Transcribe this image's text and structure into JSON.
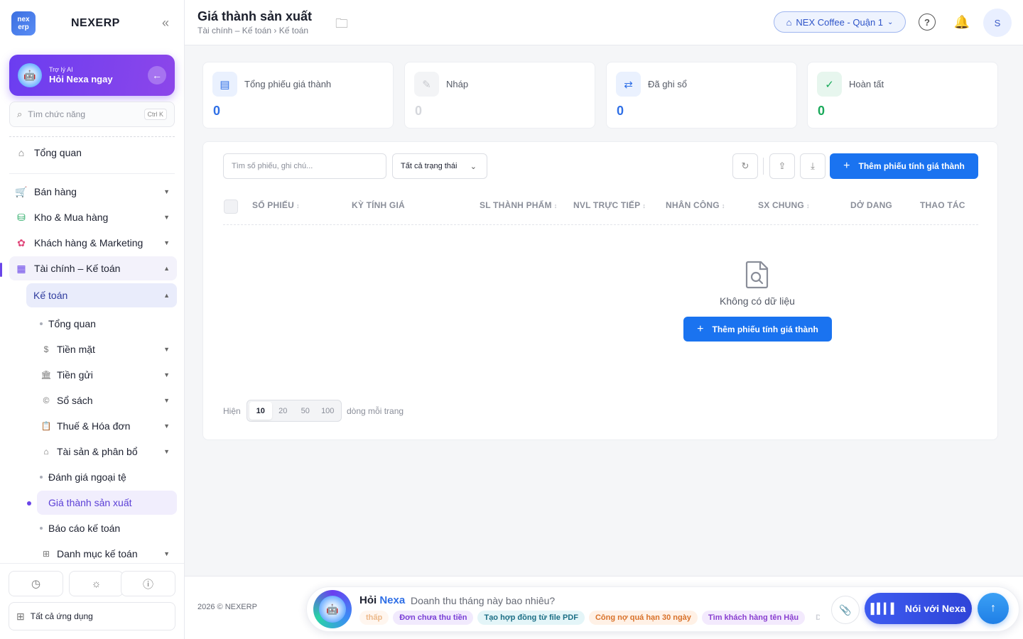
{
  "sidebar": {
    "brand": "NEXERP",
    "logo_top": "nex",
    "logo_bottom": "erp",
    "ai_card": {
      "subtitle": "Trợ lý AI",
      "title": "Hỏi Nexa ngay"
    },
    "search": {
      "placeholder": "Tìm chức năng",
      "shortcut": "Ctrl K"
    },
    "items": [
      {
        "label": "Tổng quan"
      },
      {
        "label": "Bán hàng"
      },
      {
        "label": "Kho & Mua hàng"
      },
      {
        "label": "Khách hàng & Marketing"
      },
      {
        "label": "Tài chính – Kế toán"
      }
    ],
    "sub_group": "Kế toán",
    "leaves": [
      {
        "label": "Tổng quan"
      },
      {
        "label": "Tiền mặt"
      },
      {
        "label": "Tiền gửi"
      },
      {
        "label": "Sổ sách"
      },
      {
        "label": "Thuế & Hóa đơn"
      },
      {
        "label": "Tài sản & phân bổ"
      },
      {
        "label": "Đánh giá ngoại tệ"
      },
      {
        "label": "Giá thành sản xuất"
      },
      {
        "label": "Báo cáo kế toán"
      },
      {
        "label": "Danh mục kế toán"
      }
    ],
    "all_apps": "Tất cả ứng dụng"
  },
  "header": {
    "title": "Giá thành sản xuất",
    "breadcrumb": "Tài chính – Kế toán › Kế toán",
    "store": "NEX Coffee - Quận 1",
    "avatar_initial": "S"
  },
  "stats": [
    {
      "label": "Tổng phiếu giá thành",
      "value": "0",
      "color": "#2f6fe6"
    },
    {
      "label": "Nháp",
      "value": "0",
      "color": "#d5d7dc"
    },
    {
      "label": "Đã ghi sổ",
      "value": "0",
      "color": "#2f6fe6"
    },
    {
      "label": "Hoàn tất",
      "value": "0",
      "color": "#19a95a"
    }
  ],
  "toolbar": {
    "search_placeholder": "Tìm số phiếu, ghi chú...",
    "status_filter": "Tất cả trạng thái",
    "add_label": "Thêm phiếu tính giá thành"
  },
  "table": {
    "columns": [
      "SỐ PHIẾU",
      "KỲ TÍNH GIÁ",
      "SL THÀNH PHẨM",
      "NVL TRỰC TIẾP",
      "NHÂN CÔNG",
      "SX CHUNG",
      "DỞ DANG",
      "THAO TÁC"
    ],
    "empty_text": "Không có dữ liệu",
    "empty_add_label": "Thêm phiếu tính giá thành"
  },
  "pagination": {
    "prefix": "Hiện",
    "sizes": [
      "10",
      "20",
      "50",
      "100"
    ],
    "selected": "10",
    "suffix": "dòng mỗi trang"
  },
  "footer": {
    "copyright": "2026 © NEXERP",
    "nexa_hoi": "Hỏi",
    "nexa_brand": "Nexa",
    "question": "Doanh thu tháng này bao nhiêu?",
    "chips": [
      {
        "label": "thấp",
        "bg": "#fff1e6",
        "fg": "#e08a3c"
      },
      {
        "label": "Đơn chưa thu tiền",
        "bg": "#f1eafd",
        "fg": "#7a3fd6"
      },
      {
        "label": "Tạo hợp đồng từ file PDF",
        "bg": "#e4f5f8",
        "fg": "#1d6f86"
      },
      {
        "label": "Công nợ quá hạn 30 ngày",
        "bg": "#fff1e6",
        "fg": "#d9722a"
      },
      {
        "label": "Tìm khách hàng tên Hậu",
        "bg": "#f3eafd",
        "fg": "#8a3fd0"
      },
      {
        "label": "D",
        "bg": "#ffffff",
        "fg": "#cfd2d8"
      }
    ],
    "talk_label": "Nói với Nexa"
  }
}
